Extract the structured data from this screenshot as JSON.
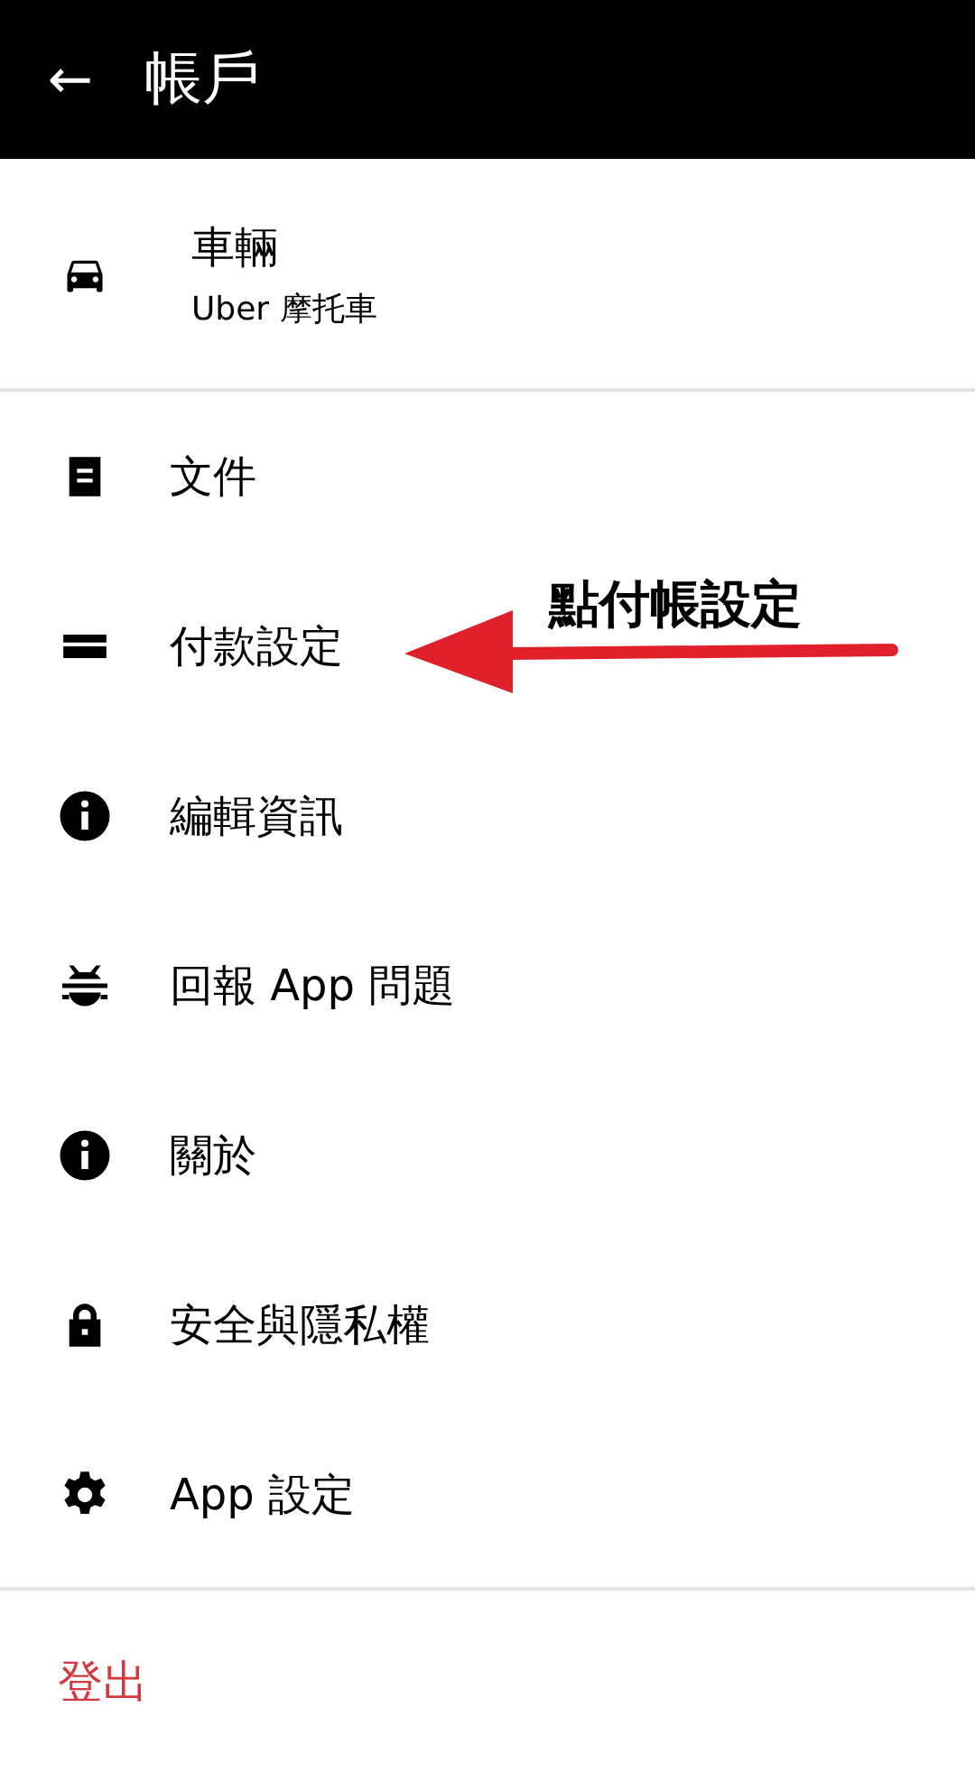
{
  "header": {
    "back_icon": "←",
    "title": "帳戶"
  },
  "vehicle": {
    "kind": "car",
    "title": "車輛",
    "subtitle": "Uber 摩托車"
  },
  "menu": [
    {
      "kind": "document",
      "label": "文件"
    },
    {
      "kind": "card",
      "label": "付款設定"
    },
    {
      "kind": "info",
      "label": "編輯資訊"
    },
    {
      "kind": "bug",
      "label": "回報 App 問題"
    },
    {
      "kind": "info",
      "label": "關於"
    },
    {
      "kind": "lock",
      "label": "安全與隱私權"
    },
    {
      "kind": "gear",
      "label": "App 設定"
    }
  ],
  "logout": "登出",
  "annotation": {
    "text": "點付帳設定"
  }
}
